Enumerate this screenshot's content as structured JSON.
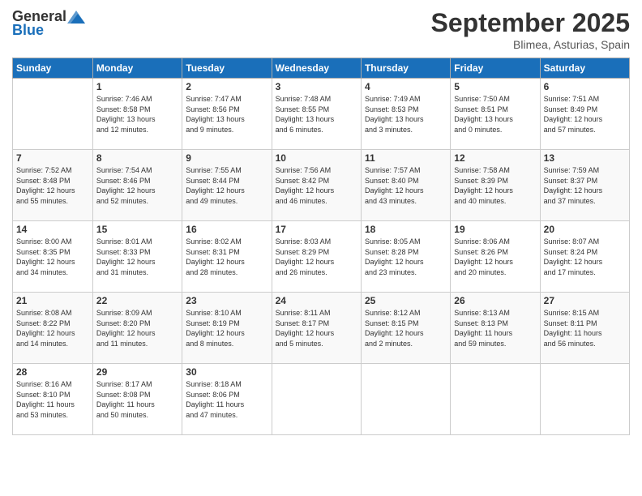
{
  "header": {
    "logo_general": "General",
    "logo_blue": "Blue",
    "title": "September 2025",
    "location": "Blimea, Asturias, Spain"
  },
  "days_of_week": [
    "Sunday",
    "Monday",
    "Tuesday",
    "Wednesday",
    "Thursday",
    "Friday",
    "Saturday"
  ],
  "weeks": [
    [
      {
        "num": "",
        "info": ""
      },
      {
        "num": "1",
        "info": "Sunrise: 7:46 AM\nSunset: 8:58 PM\nDaylight: 13 hours\nand 12 minutes."
      },
      {
        "num": "2",
        "info": "Sunrise: 7:47 AM\nSunset: 8:56 PM\nDaylight: 13 hours\nand 9 minutes."
      },
      {
        "num": "3",
        "info": "Sunrise: 7:48 AM\nSunset: 8:55 PM\nDaylight: 13 hours\nand 6 minutes."
      },
      {
        "num": "4",
        "info": "Sunrise: 7:49 AM\nSunset: 8:53 PM\nDaylight: 13 hours\nand 3 minutes."
      },
      {
        "num": "5",
        "info": "Sunrise: 7:50 AM\nSunset: 8:51 PM\nDaylight: 13 hours\nand 0 minutes."
      },
      {
        "num": "6",
        "info": "Sunrise: 7:51 AM\nSunset: 8:49 PM\nDaylight: 12 hours\nand 57 minutes."
      }
    ],
    [
      {
        "num": "7",
        "info": "Sunrise: 7:52 AM\nSunset: 8:48 PM\nDaylight: 12 hours\nand 55 minutes."
      },
      {
        "num": "8",
        "info": "Sunrise: 7:54 AM\nSunset: 8:46 PM\nDaylight: 12 hours\nand 52 minutes."
      },
      {
        "num": "9",
        "info": "Sunrise: 7:55 AM\nSunset: 8:44 PM\nDaylight: 12 hours\nand 49 minutes."
      },
      {
        "num": "10",
        "info": "Sunrise: 7:56 AM\nSunset: 8:42 PM\nDaylight: 12 hours\nand 46 minutes."
      },
      {
        "num": "11",
        "info": "Sunrise: 7:57 AM\nSunset: 8:40 PM\nDaylight: 12 hours\nand 43 minutes."
      },
      {
        "num": "12",
        "info": "Sunrise: 7:58 AM\nSunset: 8:39 PM\nDaylight: 12 hours\nand 40 minutes."
      },
      {
        "num": "13",
        "info": "Sunrise: 7:59 AM\nSunset: 8:37 PM\nDaylight: 12 hours\nand 37 minutes."
      }
    ],
    [
      {
        "num": "14",
        "info": "Sunrise: 8:00 AM\nSunset: 8:35 PM\nDaylight: 12 hours\nand 34 minutes."
      },
      {
        "num": "15",
        "info": "Sunrise: 8:01 AM\nSunset: 8:33 PM\nDaylight: 12 hours\nand 31 minutes."
      },
      {
        "num": "16",
        "info": "Sunrise: 8:02 AM\nSunset: 8:31 PM\nDaylight: 12 hours\nand 28 minutes."
      },
      {
        "num": "17",
        "info": "Sunrise: 8:03 AM\nSunset: 8:29 PM\nDaylight: 12 hours\nand 26 minutes."
      },
      {
        "num": "18",
        "info": "Sunrise: 8:05 AM\nSunset: 8:28 PM\nDaylight: 12 hours\nand 23 minutes."
      },
      {
        "num": "19",
        "info": "Sunrise: 8:06 AM\nSunset: 8:26 PM\nDaylight: 12 hours\nand 20 minutes."
      },
      {
        "num": "20",
        "info": "Sunrise: 8:07 AM\nSunset: 8:24 PM\nDaylight: 12 hours\nand 17 minutes."
      }
    ],
    [
      {
        "num": "21",
        "info": "Sunrise: 8:08 AM\nSunset: 8:22 PM\nDaylight: 12 hours\nand 14 minutes."
      },
      {
        "num": "22",
        "info": "Sunrise: 8:09 AM\nSunset: 8:20 PM\nDaylight: 12 hours\nand 11 minutes."
      },
      {
        "num": "23",
        "info": "Sunrise: 8:10 AM\nSunset: 8:19 PM\nDaylight: 12 hours\nand 8 minutes."
      },
      {
        "num": "24",
        "info": "Sunrise: 8:11 AM\nSunset: 8:17 PM\nDaylight: 12 hours\nand 5 minutes."
      },
      {
        "num": "25",
        "info": "Sunrise: 8:12 AM\nSunset: 8:15 PM\nDaylight: 12 hours\nand 2 minutes."
      },
      {
        "num": "26",
        "info": "Sunrise: 8:13 AM\nSunset: 8:13 PM\nDaylight: 11 hours\nand 59 minutes."
      },
      {
        "num": "27",
        "info": "Sunrise: 8:15 AM\nSunset: 8:11 PM\nDaylight: 11 hours\nand 56 minutes."
      }
    ],
    [
      {
        "num": "28",
        "info": "Sunrise: 8:16 AM\nSunset: 8:10 PM\nDaylight: 11 hours\nand 53 minutes."
      },
      {
        "num": "29",
        "info": "Sunrise: 8:17 AM\nSunset: 8:08 PM\nDaylight: 11 hours\nand 50 minutes."
      },
      {
        "num": "30",
        "info": "Sunrise: 8:18 AM\nSunset: 8:06 PM\nDaylight: 11 hours\nand 47 minutes."
      },
      {
        "num": "",
        "info": ""
      },
      {
        "num": "",
        "info": ""
      },
      {
        "num": "",
        "info": ""
      },
      {
        "num": "",
        "info": ""
      }
    ]
  ]
}
